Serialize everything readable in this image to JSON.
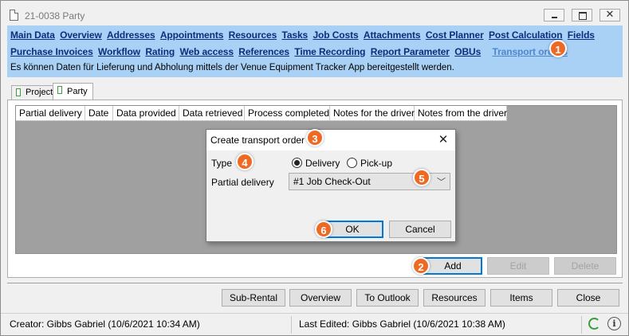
{
  "window": {
    "title": "21-0038 Party"
  },
  "nav": {
    "row1": [
      "Main Data",
      "Overview",
      "Addresses",
      "Appointments",
      "Resources",
      "Tasks",
      "Job Costs",
      "Attachments",
      "Cost Planner",
      "Post Calculation",
      "Fields"
    ],
    "row2": [
      "Purchase Invoices",
      "Workflow",
      "Rating",
      "Web access",
      "References",
      "Time Recording",
      "Report Parameter",
      "OBUs"
    ],
    "active": "Transport orders",
    "info": "Es können Daten für Lieferung und Abholung mittels der Venue Equipment Tracker App bereitgestellt werden."
  },
  "tabs": {
    "project": "Project",
    "party": "Party"
  },
  "grid": {
    "columns": [
      "Partial delivery",
      "Date",
      "Data provided",
      "Data retrieved",
      "Process completed",
      "Notes for the driver",
      "Notes from the driver"
    ]
  },
  "grid_buttons": {
    "add": "Add",
    "edit": "Edit",
    "delete": "Delete"
  },
  "bottom_buttons": [
    "Sub-Rental",
    "Overview",
    "To Outlook",
    "Resources",
    "Items",
    "Close"
  ],
  "status": {
    "creator": "Creator: Gibbs Gabriel (10/6/2021 10:34 AM)",
    "last_edited": "Last Edited:  Gibbs Gabriel (10/6/2021 10:38 AM)",
    "info_glyph": "i"
  },
  "dialog": {
    "title": "Create transport order",
    "close_glyph": "✕",
    "type_label": "Type",
    "radio_delivery": "Delivery",
    "radio_pickup": "Pick-up",
    "selected_type": "Delivery",
    "partial_label": "Partial delivery",
    "partial_value": "#1 Job Check-Out",
    "ok": "OK",
    "cancel": "Cancel"
  },
  "markers": [
    "1",
    "2",
    "3",
    "4",
    "5",
    "6"
  ],
  "colors": {
    "panel_bg": "#a9d0f5",
    "link": "#0b2f7d",
    "active_link": "#4f86ce",
    "marker": "#ee6a24"
  }
}
